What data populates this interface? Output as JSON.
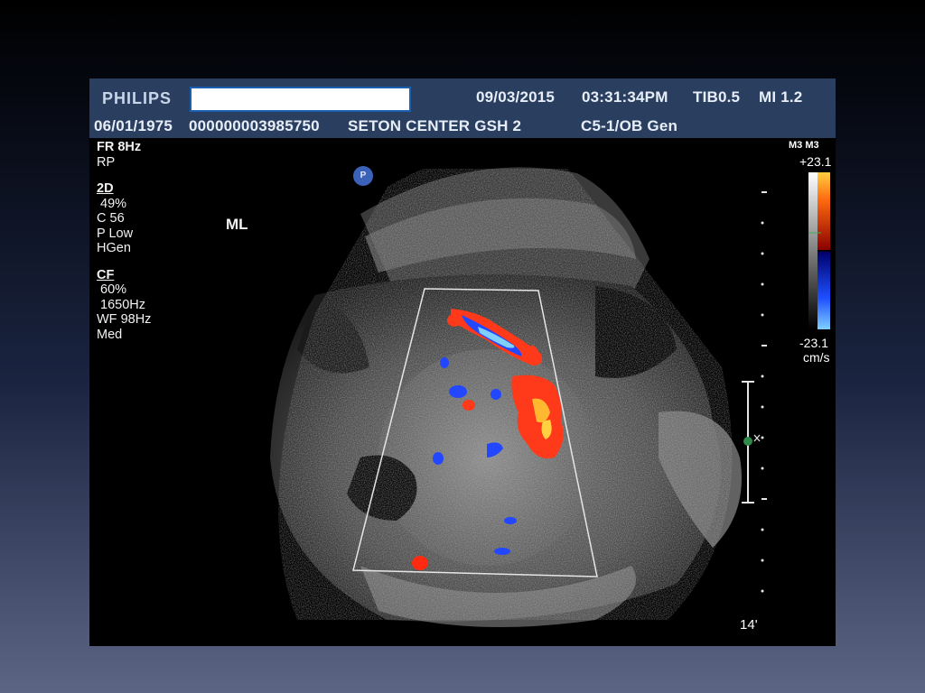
{
  "header": {
    "brand": "PHILIPS",
    "date": "09/03/2015",
    "time": "03:31:34PM",
    "tib": "TIB0.5",
    "mi": "MI 1.2",
    "dob": "06/01/1975",
    "patient_id": "000000003985750",
    "facility": "SETON CENTER GSH 2",
    "probe": "C5-1/OB Gen"
  },
  "params": {
    "fr": "FR 8Hz",
    "rp": "RP",
    "mode_2d": "2D",
    "gain_2d": " 49%",
    "compress": "C 56",
    "power": "P Low",
    "freq": "HGen",
    "mode_cf": "CF",
    "gain_cf": " 60%",
    "prf": " 1650Hz",
    "wf": "WF 98Hz",
    "flow": "Med"
  },
  "annotation": {
    "orientation": "ML",
    "marker": "P"
  },
  "color_scale": {
    "label": "M3 M3",
    "max": "+23.1",
    "min": "-23.1",
    "unit": "cm/s",
    "colors": {
      "positive": "#ff3a1a",
      "positive_peak": "#ffd040",
      "negative": "#1f4fff",
      "negative_peak": "#7fd0ff"
    }
  },
  "depth": {
    "label": "14"
  }
}
